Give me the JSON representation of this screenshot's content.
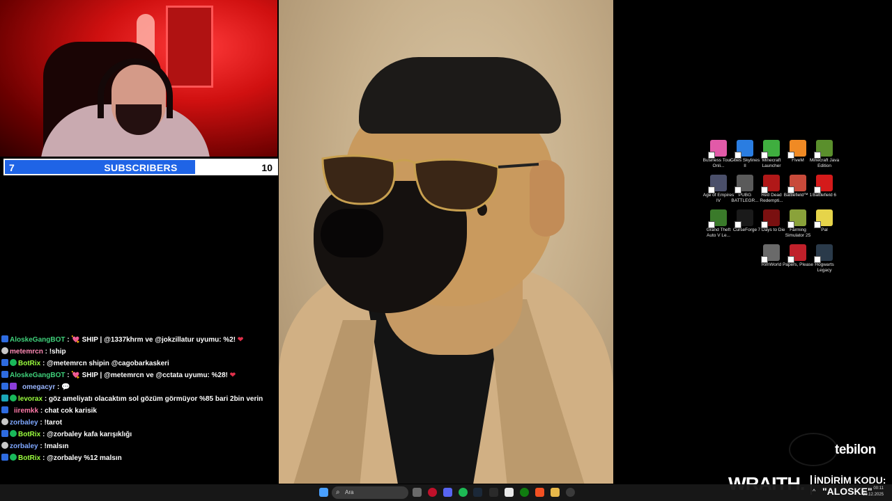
{
  "subscribers": {
    "current": "7",
    "label": "SUBSCRIBERS",
    "goal": "10",
    "progress_fraction": 0.7
  },
  "chat": [
    {
      "user": "AloskeGangBOT",
      "sep": ":",
      "text": "💘 SHIP | @1337khrm ve @jokzillatur uyumu: %2!",
      "heart": "❤"
    },
    {
      "user": "metemrcn",
      "sep": ":",
      "text": "!ship"
    },
    {
      "user": "BotRix",
      "sep": ":",
      "text": "@metemrcn shipin @cagobarkaskeri"
    },
    {
      "user": "AloskeGangBOT",
      "sep": ":",
      "text": "💘 SHIP | @metemrcn ve @cctata uyumu: %28!",
      "heart": "❤"
    },
    {
      "user": "omegacyr",
      "sep": ":",
      "text": "💬"
    },
    {
      "user": "levorax",
      "sep": ":",
      "text": "göz ameliyatı olacaktım sol gözüm görmüyor %85 bari 2bin verin"
    },
    {
      "user": "iiremkk",
      "sep": ":",
      "text": "chat cok karisik"
    },
    {
      "user": "zorbaley",
      "sep": ":",
      "text": "!tarot"
    },
    {
      "user": "BotRix",
      "sep": ":",
      "text": "@zorbaley kafa karışıklığı"
    },
    {
      "user": "zorbaley",
      "sep": ":",
      "text": "!malsın"
    },
    {
      "user": "BotRix",
      "sep": ":",
      "text": "@zorbaley %12 malsın"
    }
  ],
  "desktop_icons": [
    {
      "label": "Business Tour - Onli...",
      "icon": "business-tour-icon",
      "color": "#e25aa8"
    },
    {
      "label": "Cities Skylines II",
      "icon": "cities-skylines-icon",
      "color": "#2a7de1"
    },
    {
      "label": "Minecraft Launcher",
      "icon": "minecraft-launcher-icon",
      "color": "#3fae3f"
    },
    {
      "label": "FiveM",
      "icon": "fivem-icon",
      "color": "#f08a24"
    },
    {
      "label": "Minecraft Java Edition",
      "icon": "minecraft-java-icon",
      "color": "#5a8f2c"
    },
    {
      "label": "Age of Empires IV",
      "icon": "age-of-empires-icon",
      "color": "#4a4f6a"
    },
    {
      "label": "PUBG BATTLEGR...",
      "icon": "pubg-icon",
      "color": "#5a5a5a"
    },
    {
      "label": "Red Dead Redempti...",
      "icon": "red-dead-icon",
      "color": "#b01818"
    },
    {
      "label": "Battlefield™ 1",
      "icon": "battlefield1-icon",
      "color": "#c84a3a"
    },
    {
      "label": "Battlefield 6",
      "icon": "battlefield6-icon",
      "color": "#d41a1a"
    },
    {
      "label": "Grand Theft Auto V Le...",
      "icon": "gta-v-icon",
      "color": "#3a7a2a"
    },
    {
      "label": "CurseForge",
      "icon": "curseforge-icon",
      "color": "#1a1a1a"
    },
    {
      "label": "7 Days to Die",
      "icon": "seven-days-icon",
      "color": "#7a1010"
    },
    {
      "label": "Farming Simulator 25",
      "icon": "farming-sim-icon",
      "color": "#8aa23a"
    },
    {
      "label": "Pal",
      "icon": "pal-icon",
      "color": "#e6d44a"
    },
    {
      "label": "RimWorld",
      "icon": "rimworld-icon",
      "color": "#6a6a6a"
    },
    {
      "label": "Papers, Please",
      "icon": "papers-please-icon",
      "color": "#c0202a"
    },
    {
      "label": "Hogwarts Legacy",
      "icon": "hogwarts-icon",
      "color": "#2a3a4a"
    }
  ],
  "sponsor": {
    "tebilon": "tebilon",
    "wraith": "WRAITH.",
    "promo_label": "İNDİRİM KODU:",
    "promo_code": "\"ALOSKE\""
  },
  "taskbar": {
    "search_placeholder": "Ara",
    "time": "00:11",
    "date": "29.12.2025"
  }
}
